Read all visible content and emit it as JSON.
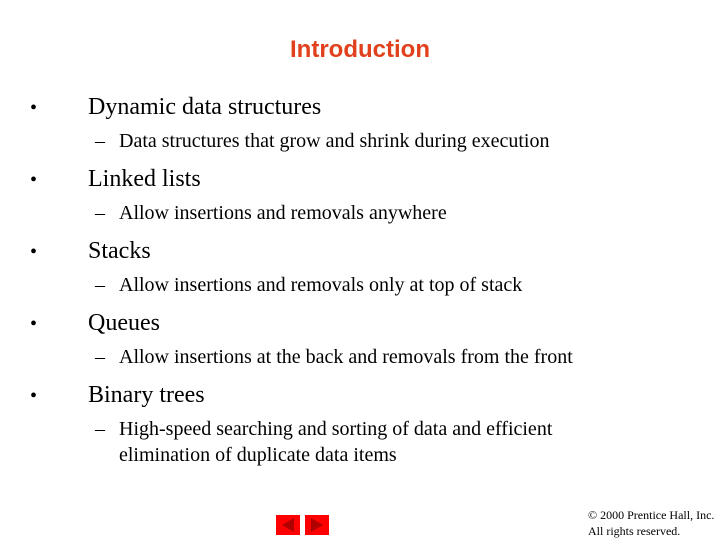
{
  "slide": {
    "title": "Introduction",
    "title_color": "#e0401c",
    "bullets": [
      {
        "text": "Dynamic data structures",
        "sub": [
          "Data structures that grow and shrink during execution"
        ]
      },
      {
        "text": "Linked lists",
        "sub": [
          "Allow insertions and removals anywhere"
        ]
      },
      {
        "text": "Stacks",
        "sub": [
          "Allow insertions and removals only at top of stack"
        ]
      },
      {
        "text": "Queues",
        "sub": [
          "Allow insertions at the back and removals from the front"
        ]
      },
      {
        "text": "Binary trees",
        "sub": [
          "High-speed searching and sorting of data and efficient",
          "elimination of duplicate data items"
        ]
      }
    ],
    "bullet_glyph": "•",
    "dash_glyph": "–"
  },
  "nav": {
    "prev_icon": "triangle-left-icon",
    "next_icon": "triangle-right-icon",
    "button_color": "#ff0000",
    "arrow_color": "#b00000"
  },
  "footer": {
    "copyright_line1": "© 2000 Prentice Hall, Inc.",
    "copyright_line2": "All rights reserved."
  }
}
